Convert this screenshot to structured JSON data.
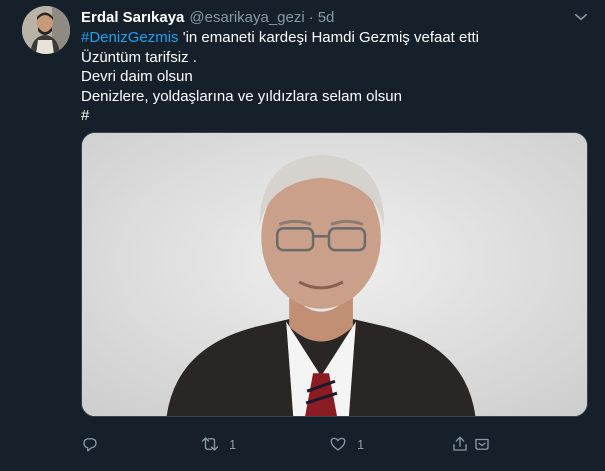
{
  "tweet": {
    "author_name": "Erdal Sarıkaya",
    "handle": "@esarikaya_gezi",
    "separator": "·",
    "time": "5d",
    "hashtag": "#DenizGezmis",
    "line1_rest": " 'in emaneti kardeşi Hamdi Gezmiş vefaat etti",
    "line2": "Üzüntüm tarifsiz .",
    "line3": "Devri daim olsun",
    "line4": "Denizlere, yoldaşlarına ve yıldızlara selam olsun",
    "line5": "#",
    "actions": {
      "reply_count": "",
      "retweet_count": "1",
      "like_count": "1"
    }
  },
  "colors": {
    "background": "#15202b",
    "text": "#ffffff",
    "secondary": "#8899a6",
    "accent": "#1da1f2"
  },
  "icons": [
    "caret-down-icon",
    "reply-icon",
    "retweet-icon",
    "like-icon",
    "share-icon"
  ]
}
